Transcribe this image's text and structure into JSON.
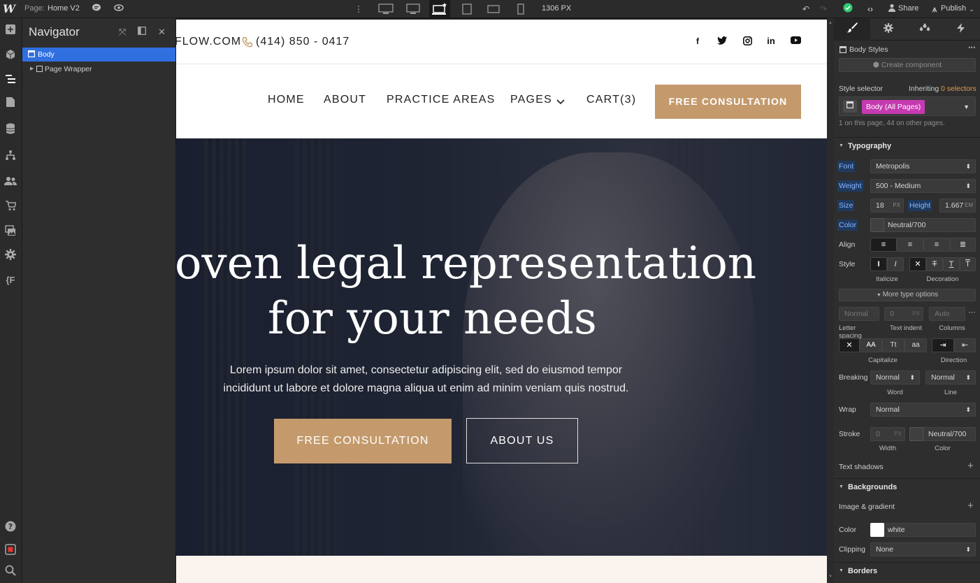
{
  "topbar": {
    "page_prefix": "Page:",
    "page_name": "Home V2",
    "viewport_width": "1306 PX",
    "share": "Share",
    "publish": "Publish"
  },
  "navigator": {
    "title": "Navigator",
    "items": [
      {
        "label": "Body"
      },
      {
        "label": "Page Wrapper"
      }
    ]
  },
  "site": {
    "email_fragment": "FLOW.COM",
    "phone": "(414) 850 - 0417",
    "social_icons": [
      "facebook-icon",
      "twitter-icon",
      "instagram-icon",
      "linkedin-icon",
      "youtube-icon"
    ],
    "nav": [
      "HOME",
      "ABOUT",
      "PRACTICE AREAS",
      "PAGES",
      "CART(3)"
    ],
    "nav_cta": "FREE CONSULTATION",
    "hero": {
      "title_line1": "oven legal representation",
      "title_line2": "for your needs",
      "subtitle_line1": "Lorem ipsum dolor sit amet, consectetur adipiscing elit, sed do eiusmod tempor",
      "subtitle_line2": "incididunt ut labore et dolore magna aliqua ut enim ad minim veniam quis nostrud.",
      "button_primary": "FREE CONSULTATION",
      "button_secondary": "ABOUT US"
    }
  },
  "style_panel": {
    "element_title": "Body Styles",
    "create_component": "Create component",
    "style_selector_label": "Style selector",
    "inheriting": "Inheriting",
    "inheriting_count": "0 selectors",
    "selector_tag": "Body (All Pages)",
    "usage_note": "1 on this page, 44 on other pages.",
    "typography": {
      "header": "Typography",
      "font_label": "Font",
      "font_value": "Metropolis",
      "weight_label": "Weight",
      "weight_value": "500 - Medium",
      "size_label": "Size",
      "size_value": "18",
      "size_unit": "PX",
      "height_label": "Height",
      "height_value": "1.667",
      "height_unit": "EM",
      "color_label": "Color",
      "color_value": "Neutral/700",
      "align_label": "Align",
      "style_label": "Style",
      "italicize": "Italicize",
      "decoration": "Decoration",
      "more_options": "More type options",
      "letter_spacing_value": "Normal",
      "letter_spacing_label": "Letter spacing",
      "text_indent_value": "0",
      "text_indent_unit": "PX",
      "text_indent_label": "Text indent",
      "columns_value": "Auto",
      "columns_label": "Columns",
      "capitalize_label": "Capitalize",
      "capitalize_options": [
        "AA",
        "Tt",
        "aa"
      ],
      "direction_label": "Direction",
      "breaking_label": "Breaking",
      "breaking_word": "Normal",
      "breaking_line": "Normal",
      "word_label": "Word",
      "line_label": "Line",
      "wrap_label": "Wrap",
      "wrap_value": "Normal",
      "stroke_label": "Stroke",
      "stroke_width": "0",
      "stroke_unit": "PX",
      "stroke_color": "Neutral/700",
      "width_label": "Width",
      "color_sub_label": "Color",
      "text_shadows": "Text shadows"
    },
    "backgrounds": {
      "header": "Backgrounds",
      "image_gradient": "Image & gradient",
      "color_label": "Color",
      "color_value": "white",
      "clipping_label": "Clipping",
      "clipping_value": "None"
    },
    "borders": {
      "header": "Borders"
    }
  },
  "colors": {
    "accent_gold": "#c49a6c",
    "selection_blue": "#2f6fe0",
    "selector_pink": "#c53ab0",
    "status_green": "#2ecc71"
  }
}
